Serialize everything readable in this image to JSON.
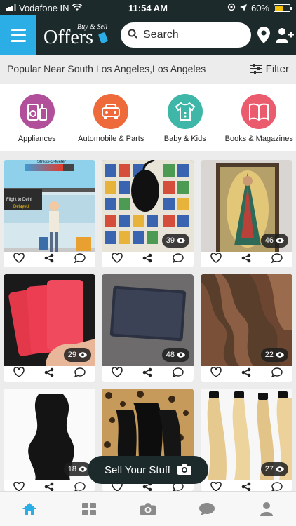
{
  "status_bar": {
    "carrier": "Vodafone IN",
    "time": "11:54 AM",
    "battery": "60%"
  },
  "header": {
    "logo_main": "Offers",
    "logo_small": "Buy & Sell",
    "search_placeholder": "Search"
  },
  "location_bar": {
    "text": "Popular Near South Los Angeles,Los Angeles",
    "filter_label": "Filter"
  },
  "categories": [
    {
      "label": "Appliances",
      "color": "#b14f9b",
      "icon": "appliances-icon"
    },
    {
      "label": "Automobile & Parts",
      "color": "#ee6a3a",
      "icon": "car-icon"
    },
    {
      "label": "Baby & Kids",
      "color": "#3fb7a8",
      "icon": "baby-clothes-icon"
    },
    {
      "label": "Books & Magazines",
      "color": "#ea5b6d",
      "icon": "book-icon"
    }
  ],
  "listings": [
    {
      "views": "",
      "desc": "stress-meter cartoon"
    },
    {
      "views": "39",
      "desc": "mouse on loteria cards"
    },
    {
      "views": "46",
      "desc": "virgin mary painting"
    },
    {
      "views": "",
      "desc": "red iphones"
    },
    {
      "views": "48",
      "desc": "laptop"
    },
    {
      "views": "22",
      "desc": "brown hair bundles"
    },
    {
      "views": "18",
      "desc": "black wavy hair"
    },
    {
      "views": "",
      "desc": "hair bundles on leopard print"
    },
    {
      "views": "27",
      "desc": "blonde hair bundles"
    }
  ],
  "listing_views": {
    "l1": "39",
    "l2": "46",
    "l3": "29",
    "l4": "48",
    "l5": "22",
    "l6": "18",
    "l8": "27"
  },
  "cartoon_text": {
    "meter": "Stress-O-Meter",
    "board": "Flight to Delhi",
    "status": "Delayed"
  },
  "sell_button": {
    "label": "Sell Your Stuff"
  },
  "tabs": [
    "home-icon",
    "grid-icon",
    "camera-icon",
    "chat-icon",
    "profile-icon"
  ]
}
